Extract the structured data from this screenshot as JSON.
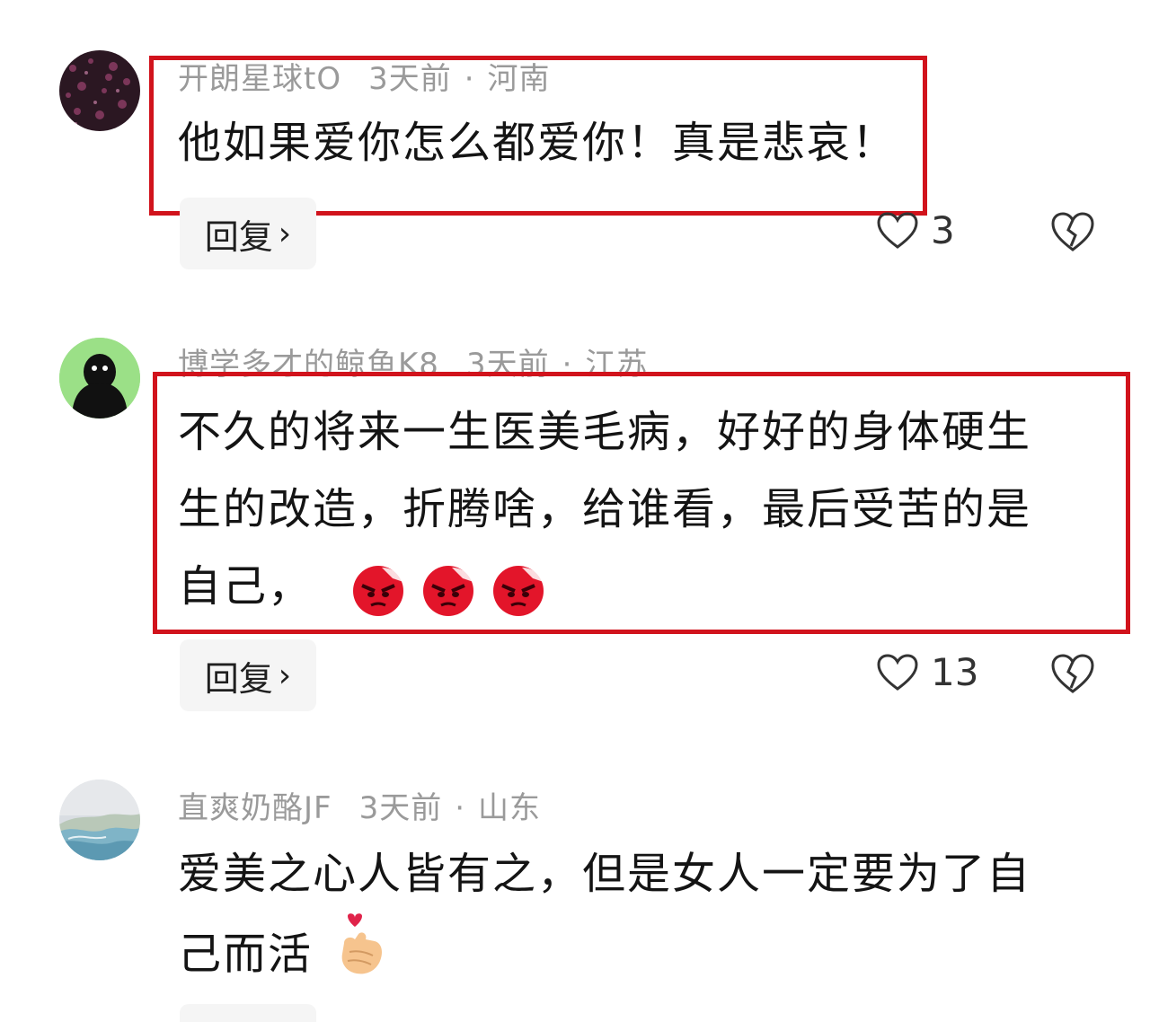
{
  "comments": [
    {
      "username": "开朗星球tO",
      "time": "3天前",
      "separator": "·",
      "location": "河南",
      "text": "他如果爱你怎么都爱你！真是悲哀！",
      "reply_label": "回复",
      "reply_chevron": "›",
      "likes": "3"
    },
    {
      "username": "博学多才的鲸鱼K8",
      "time": "3天前",
      "separator": "·",
      "location": "江苏",
      "text_line1": "不久的将来一生医美毛病，好好的身体硬生",
      "text_line2": "生的改造，折腾啥，给谁看，最后受苦的是",
      "text_line3": "自己，",
      "reply_label": "回复",
      "reply_chevron": "›",
      "likes": "13"
    },
    {
      "username": "直爽奶酪JF",
      "time": "3天前",
      "separator": "·",
      "location": "山东",
      "text_line1": "爱美之心人皆有之，但是女人一定要为了自",
      "text_line2": "己而活"
    }
  ],
  "icons": {
    "like": "heart-outline-icon",
    "dislike": "broken-heart-icon",
    "angry": "angry-face-emoji",
    "finger_heart": "finger-heart-emoji"
  },
  "colors": {
    "highlight": "#d1131c",
    "meta": "#9a9a9a",
    "reply_bg": "#f5f5f5"
  }
}
